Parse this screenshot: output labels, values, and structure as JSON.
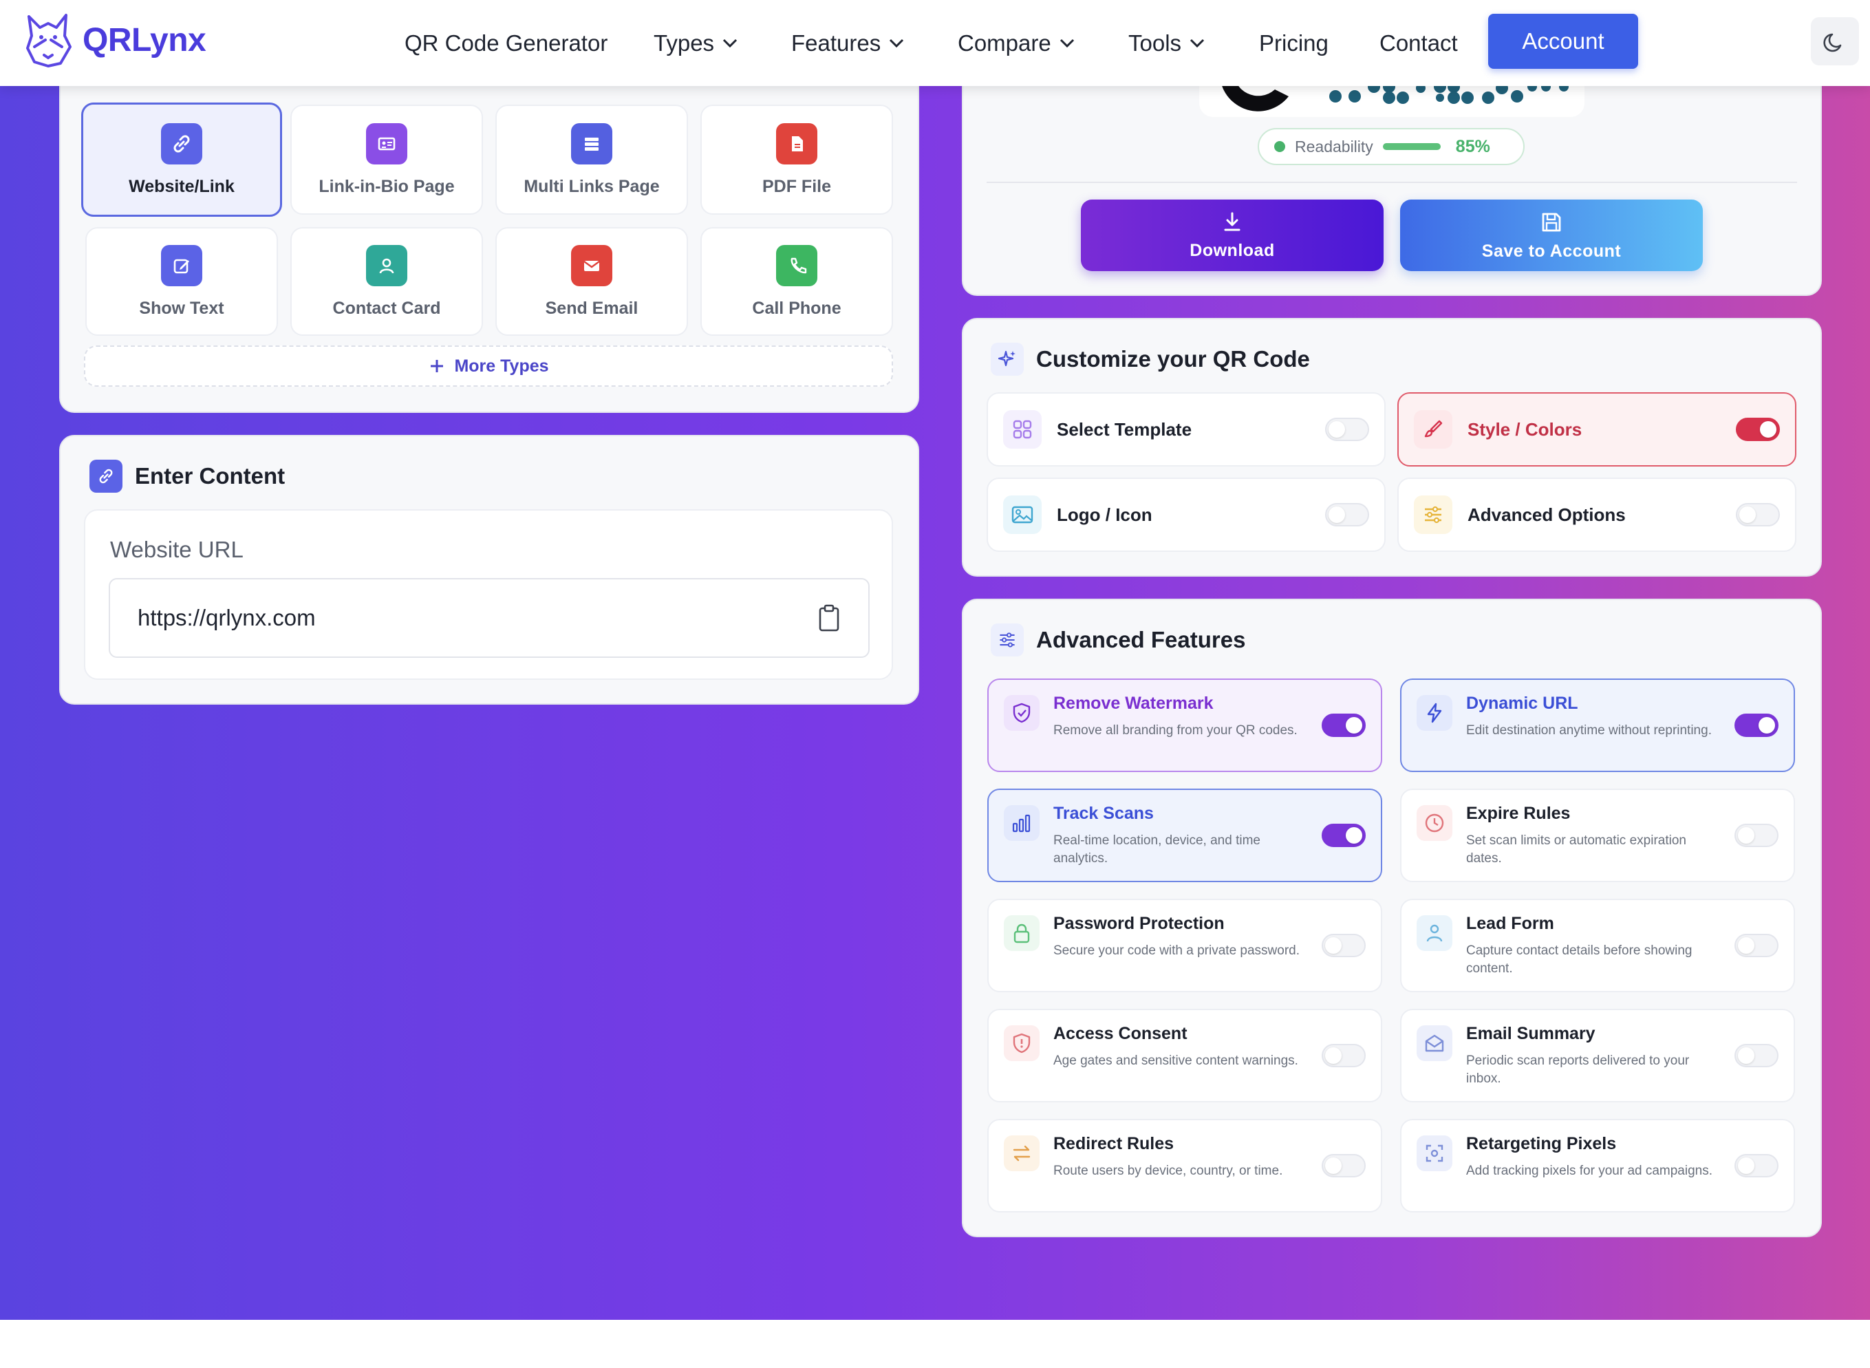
{
  "brand": {
    "name": "QRLynx",
    "color": "#4a3cdc"
  },
  "nav": {
    "items": [
      {
        "label": "QR Code Generator",
        "dropdown": false
      },
      {
        "label": "Types",
        "dropdown": true
      },
      {
        "label": "Features",
        "dropdown": true
      },
      {
        "label": "Compare",
        "dropdown": true
      },
      {
        "label": "Tools",
        "dropdown": true
      },
      {
        "label": "Pricing",
        "dropdown": false
      },
      {
        "label": "Contact",
        "dropdown": false
      }
    ],
    "account_label": "Account",
    "theme_icon": "moon-icon"
  },
  "types": {
    "items": [
      {
        "label": "Website/Link",
        "icon": "link-icon",
        "color": "#5b63e6",
        "selected": true
      },
      {
        "label": "Link-in-Bio Page",
        "icon": "id-card-icon",
        "color": "#8a4ee6",
        "selected": false
      },
      {
        "label": "Multi Links Page",
        "icon": "list-icon",
        "color": "#5460e0",
        "selected": false
      },
      {
        "label": "PDF File",
        "icon": "pdf-icon",
        "color": "#e0443c",
        "selected": false
      },
      {
        "label": "Show Text",
        "icon": "edit-icon",
        "color": "#5b63e6",
        "selected": false
      },
      {
        "label": "Contact Card",
        "icon": "user-icon",
        "color": "#2fa898",
        "selected": false
      },
      {
        "label": "Send Email",
        "icon": "mail-icon",
        "color": "#e0443c",
        "selected": false
      },
      {
        "label": "Call Phone",
        "icon": "phone-icon",
        "color": "#3db661",
        "selected": false
      }
    ],
    "more_label": "More Types"
  },
  "content": {
    "title": "Enter Content",
    "field_label": "Website URL",
    "url_value": "https://qrlynx.com"
  },
  "preview": {
    "readability_label": "Readability",
    "readability_value": "85%",
    "readability_fraction": 0.85,
    "download_label": "Download",
    "save_label": "Save to Account"
  },
  "customize": {
    "title": "Customize your QR Code",
    "options": [
      {
        "label": "Select Template",
        "icon": "grid-icon",
        "on": false
      },
      {
        "label": "Style / Colors",
        "icon": "brush-icon",
        "on": true
      },
      {
        "label": "Logo / Icon",
        "icon": "image-icon",
        "on": false
      },
      {
        "label": "Advanced Options",
        "icon": "sliders-icon",
        "on": false
      }
    ]
  },
  "advanced": {
    "title": "Advanced Features",
    "features": [
      {
        "title": "Remove Watermark",
        "desc": "Remove all branding from your QR codes.",
        "icon": "shield-check-icon",
        "on": true
      },
      {
        "title": "Dynamic URL",
        "desc": "Edit destination anytime without reprinting.",
        "icon": "bolt-icon",
        "on": true
      },
      {
        "title": "Track Scans",
        "desc": "Real-time location, device, and time analytics.",
        "icon": "bar-chart-icon",
        "on": true
      },
      {
        "title": "Expire Rules",
        "desc": "Set scan limits or automatic expiration dates.",
        "icon": "clock-icon",
        "on": false
      },
      {
        "title": "Password Protection",
        "desc": "Secure your code with a private password.",
        "icon": "lock-icon",
        "on": false
      },
      {
        "title": "Lead Form",
        "desc": "Capture contact details before showing content.",
        "icon": "person-icon",
        "on": false
      },
      {
        "title": "Access Consent",
        "desc": "Age gates and sensitive content warnings.",
        "icon": "shield-alert-icon",
        "on": false
      },
      {
        "title": "Email Summary",
        "desc": "Periodic scan reports delivered to your inbox.",
        "icon": "envelope-open-icon",
        "on": false
      },
      {
        "title": "Redirect Rules",
        "desc": "Route users by device, country, or time.",
        "icon": "arrows-icon",
        "on": false
      },
      {
        "title": "Retargeting Pixels",
        "desc": "Add tracking pixels for your ad campaigns.",
        "icon": "target-icon",
        "on": false
      }
    ]
  }
}
